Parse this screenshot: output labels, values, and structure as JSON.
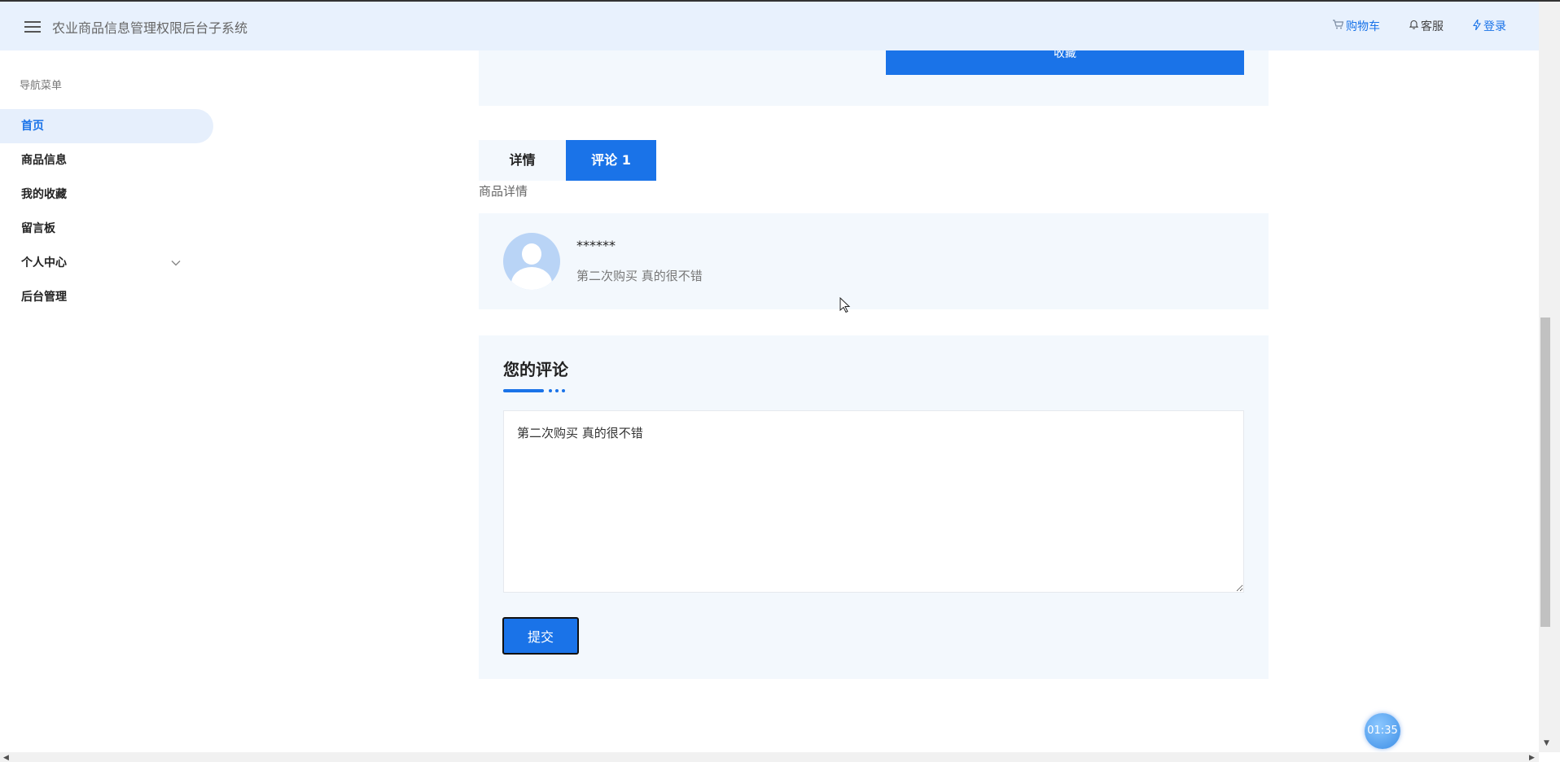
{
  "header": {
    "title": "农业商品信息管理权限后台子系统",
    "links": {
      "cart": {
        "icon": "cart-icon",
        "label": "购物车"
      },
      "service": {
        "icon": "bell-icon",
        "label": "客服"
      },
      "login": {
        "icon": "lightning-icon",
        "label": "登录"
      }
    }
  },
  "sidebar": {
    "title": "导航菜单",
    "items": [
      {
        "label": "首页",
        "active": true
      },
      {
        "label": "商品信息"
      },
      {
        "label": "我的收藏"
      },
      {
        "label": "留言板"
      },
      {
        "label": "个人中心",
        "expandable": true
      },
      {
        "label": "后台管理"
      }
    ]
  },
  "product": {
    "collect_label": "收藏"
  },
  "tabs": [
    {
      "label": "详情"
    },
    {
      "label": "评论 1",
      "active": true
    }
  ],
  "section_label": "商品详情",
  "comments": [
    {
      "user": "******",
      "text": "第二次购买 真的很不错"
    }
  ],
  "comment_form": {
    "title": "您的评论",
    "value": "第二次购买 真的很不错",
    "submit_label": "提交"
  },
  "timer": "01:35",
  "colors": {
    "accent": "#1a73e8",
    "header_bg": "#e8f1fd",
    "card_bg": "#f3f8fd"
  }
}
